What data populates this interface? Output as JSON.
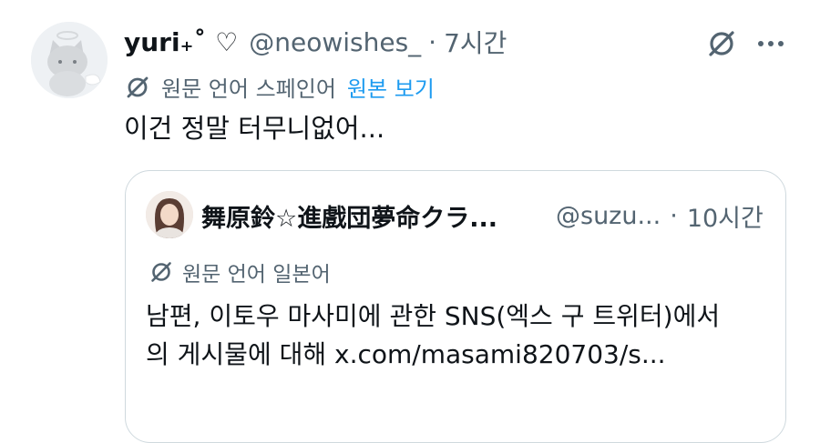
{
  "post": {
    "display_name": "yuri₊˚ ♡",
    "handle": "@neowishes_",
    "separator": "·",
    "time": "7시간",
    "translation": {
      "label": "원문 언어 스페인어",
      "link": "원본 보기"
    },
    "text": "이건 정말 터무니없어..."
  },
  "quote": {
    "display_name": "舞原鈴☆進戲団夢命クラ...",
    "handle": "@suzu...",
    "separator": "·",
    "time": "10시간",
    "translation": {
      "label": "원문 언어 일본어"
    },
    "text_lines": [
      "남편, 이토우 마사미에 관한 SNS(엑스 구 트위터)에서",
      "의 게시물에 대해 x.com/masami820703/s..."
    ]
  },
  "icons": {
    "grok": "grok-icon",
    "more": "more-icon",
    "translate": "translate-icon"
  },
  "colors": {
    "link": "#1d9bf0",
    "secondary_text": "#536471",
    "border": "#cfd9de"
  }
}
